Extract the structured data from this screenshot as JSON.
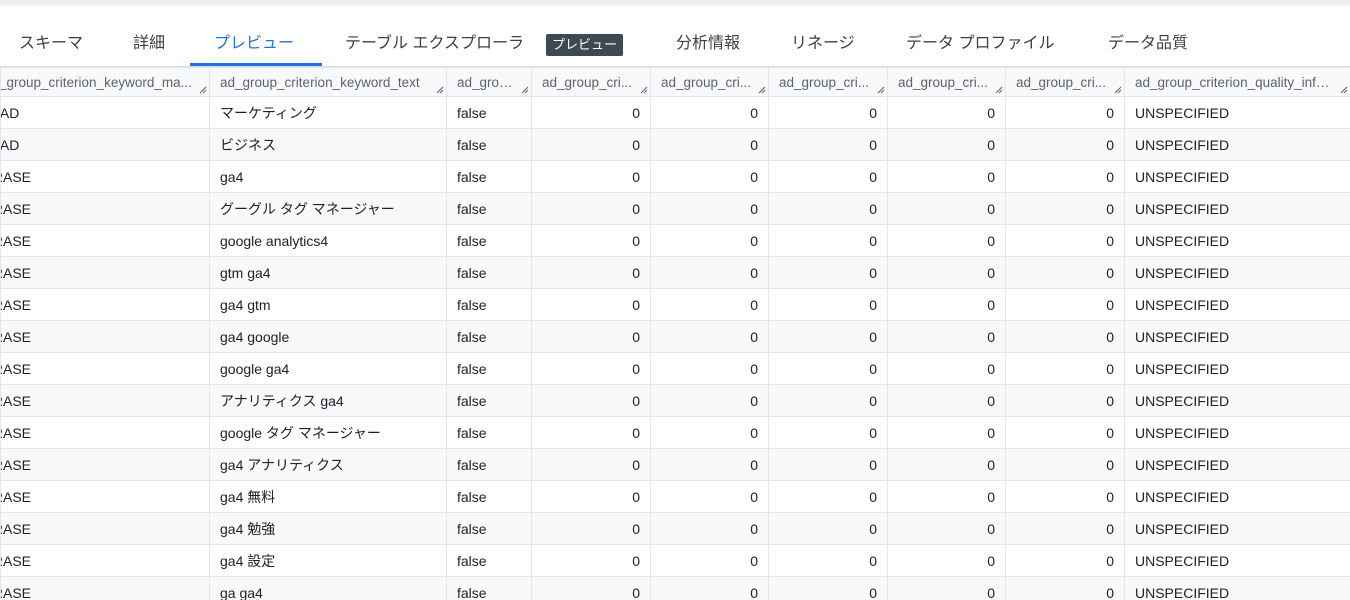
{
  "tabs": [
    {
      "label": "スキーマ",
      "active": false
    },
    {
      "label": "詳細",
      "active": false
    },
    {
      "label": "プレビュー",
      "active": true
    },
    {
      "label": "テーブル エクスプローラ",
      "active": false
    },
    {
      "label": "分析情報",
      "active": false
    },
    {
      "label": "リネージ",
      "active": false
    },
    {
      "label": "データ プロファイル",
      "active": false
    },
    {
      "label": "データ品質",
      "active": false
    }
  ],
  "explorer_badge": "プレビュー",
  "accent_color": "#1a73e8",
  "columns": [
    "_group_criterion_keyword_ma...",
    "ad_group_criterion_keyword_text",
    "ad_grou...",
    "ad_group_cri...",
    "ad_group_cri...",
    "ad_group_cri...",
    "ad_group_cri...",
    "ad_group_cri...",
    "ad_group_criterion_quality_info_..."
  ],
  "rows": [
    [
      "OAD",
      "マーケティング",
      "false",
      "0",
      "0",
      "0",
      "0",
      "0",
      "UNSPECIFIED"
    ],
    [
      "OAD",
      "ビジネス",
      "false",
      "0",
      "0",
      "0",
      "0",
      "0",
      "UNSPECIFIED"
    ],
    [
      "IRASE",
      "ga4",
      "false",
      "0",
      "0",
      "0",
      "0",
      "0",
      "UNSPECIFIED"
    ],
    [
      "IRASE",
      "グーグル タグ マネージャー",
      "false",
      "0",
      "0",
      "0",
      "0",
      "0",
      "UNSPECIFIED"
    ],
    [
      "IRASE",
      "google analytics4",
      "false",
      "0",
      "0",
      "0",
      "0",
      "0",
      "UNSPECIFIED"
    ],
    [
      "IRASE",
      "gtm ga4",
      "false",
      "0",
      "0",
      "0",
      "0",
      "0",
      "UNSPECIFIED"
    ],
    [
      "IRASE",
      "ga4 gtm",
      "false",
      "0",
      "0",
      "0",
      "0",
      "0",
      "UNSPECIFIED"
    ],
    [
      "IRASE",
      "ga4 google",
      "false",
      "0",
      "0",
      "0",
      "0",
      "0",
      "UNSPECIFIED"
    ],
    [
      "IRASE",
      "google ga4",
      "false",
      "0",
      "0",
      "0",
      "0",
      "0",
      "UNSPECIFIED"
    ],
    [
      "IRASE",
      "アナリティクス ga4",
      "false",
      "0",
      "0",
      "0",
      "0",
      "0",
      "UNSPECIFIED"
    ],
    [
      "IRASE",
      "google タグ マネージャー",
      "false",
      "0",
      "0",
      "0",
      "0",
      "0",
      "UNSPECIFIED"
    ],
    [
      "IRASE",
      "ga4 アナリティクス",
      "false",
      "0",
      "0",
      "0",
      "0",
      "0",
      "UNSPECIFIED"
    ],
    [
      "IRASE",
      "ga4 無料",
      "false",
      "0",
      "0",
      "0",
      "0",
      "0",
      "UNSPECIFIED"
    ],
    [
      "IRASE",
      "ga4 勉強",
      "false",
      "0",
      "0",
      "0",
      "0",
      "0",
      "UNSPECIFIED"
    ],
    [
      "IRASE",
      "ga4 設定",
      "false",
      "0",
      "0",
      "0",
      "0",
      "0",
      "UNSPECIFIED"
    ],
    [
      "IRASE",
      "ga ga4",
      "false",
      "0",
      "0",
      "0",
      "0",
      "0",
      "UNSPECIFIED"
    ]
  ]
}
